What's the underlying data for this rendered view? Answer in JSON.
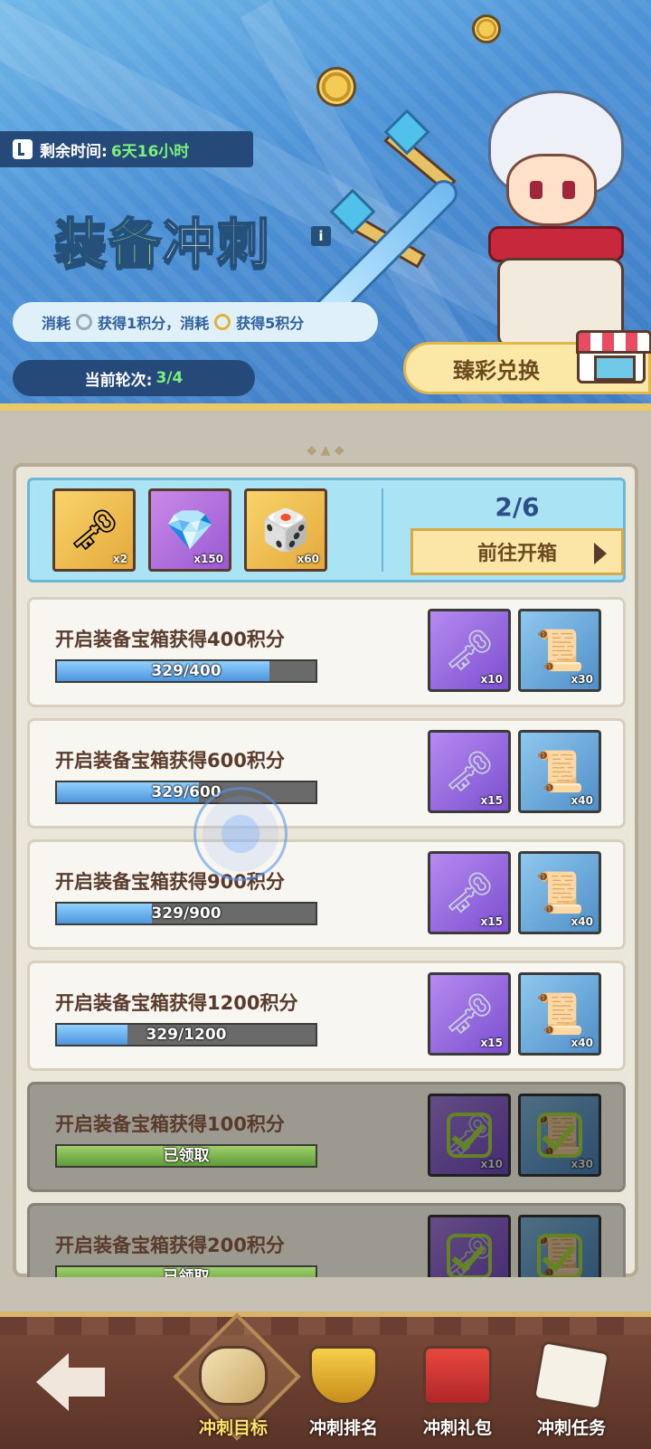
{
  "header": {
    "timer_label": "剩余时间:",
    "timer_value": "6天16小时",
    "title_part1": "装备",
    "title_part2": "冲刺",
    "info_glyph": "i",
    "cost_text1": "消耗",
    "cost_text2": "获得1积分，消耗",
    "cost_text3": "获得5积分",
    "round_label": "当前轮次:",
    "round_value": "3/4",
    "exchange_label": "臻彩兑换"
  },
  "summary": {
    "items": [
      {
        "icon": "key-icon",
        "count": "x2"
      },
      {
        "icon": "gem-icon",
        "count": "x150"
      },
      {
        "icon": "dice-icon",
        "count": "x60"
      }
    ],
    "progress": "2/6",
    "open_label": "前往开箱"
  },
  "tasks": [
    {
      "label": "开启装备宝箱获得400积分",
      "bar_text": "329/400",
      "fill": 0.8225,
      "done": false,
      "key_count": "x10",
      "scroll_count": "x30"
    },
    {
      "label": "开启装备宝箱获得600积分",
      "bar_text": "329/600",
      "fill": 0.548,
      "done": false,
      "key_count": "x15",
      "scroll_count": "x40"
    },
    {
      "label": "开启装备宝箱获得900积分",
      "bar_text": "329/900",
      "fill": 0.366,
      "done": false,
      "key_count": "x15",
      "scroll_count": "x40"
    },
    {
      "label": "开启装备宝箱获得1200积分",
      "bar_text": "329/1200",
      "fill": 0.274,
      "done": false,
      "key_count": "x15",
      "scroll_count": "x40"
    },
    {
      "label": "开启装备宝箱获得100积分",
      "bar_text": "已领取",
      "fill": 1,
      "done": true,
      "key_count": "x10",
      "scroll_count": "x30"
    },
    {
      "label": "开启装备宝箱获得200积分",
      "bar_text": "已领取",
      "fill": 1,
      "done": true,
      "key_count": "",
      "scroll_count": ""
    }
  ],
  "nav": {
    "tabs": [
      {
        "label": "冲刺目标",
        "icon": "scroll-icon",
        "active": true
      },
      {
        "label": "冲刺排名",
        "icon": "trophy-icon",
        "active": false
      },
      {
        "label": "冲刺礼包",
        "icon": "chest-icon",
        "active": false
      },
      {
        "label": "冲刺任务",
        "icon": "clipboard-icon",
        "active": false
      }
    ]
  },
  "colors": {
    "accent_green": "#7bf07b",
    "banner_blue": "#4d92d6",
    "panel": "#ebe6da"
  }
}
